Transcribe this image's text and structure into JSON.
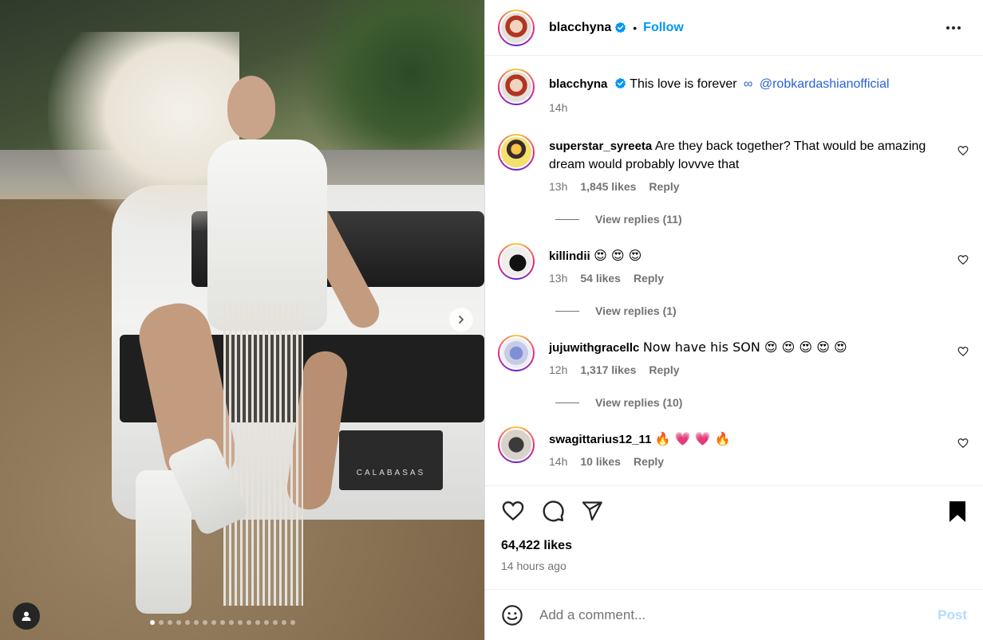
{
  "post": {
    "author": "blacchyna",
    "follow_label": "Follow",
    "separator": "•",
    "caption": "This love is forever",
    "caption_symbol": "∞",
    "caption_mention": "@robkardashianofficial",
    "caption_time": "14h",
    "photo_count": 17,
    "active_photo_index": 0,
    "plate_text": "CALABASAS"
  },
  "comments": [
    {
      "user": "superstar_syreeta",
      "text": "Are they back together? That would be amazing dream would probably lovvve that",
      "time": "13h",
      "likes": "1,845 likes",
      "reply": "Reply",
      "view_replies": "View replies (11)"
    },
    {
      "user": "killindii",
      "text": "😍 😍 😍",
      "time": "13h",
      "likes": "54 likes",
      "reply": "Reply",
      "view_replies": "View replies (1)"
    },
    {
      "user": "jujuwithgracellc",
      "text": "Now have his SON 😍 😍 😍 😍 😍",
      "time": "12h",
      "likes": "1,317 likes",
      "reply": "Reply",
      "view_replies": "View replies (10)"
    },
    {
      "user": "swagittarius12_11",
      "text": "🔥 💗 💗 🔥",
      "time": "14h",
      "likes": "10 likes",
      "reply": "Reply"
    }
  ],
  "footer": {
    "likes": "64,422 likes",
    "time_ago": "14 hours ago",
    "comment_placeholder": "Add a comment...",
    "post_label": "Post"
  },
  "icons": {
    "like": "heart-icon",
    "comment": "comment-bubble-icon",
    "share": "paper-plane-icon",
    "save": "bookmark-icon",
    "emoji": "smiley-icon",
    "more": "more-options-icon",
    "next": "chevron-right-icon",
    "tag": "user-tag-icon"
  },
  "colors": {
    "link": "#0095f6",
    "mention": "#2a61d6",
    "muted": "#737373",
    "post_disabled": "#b3dbff"
  }
}
